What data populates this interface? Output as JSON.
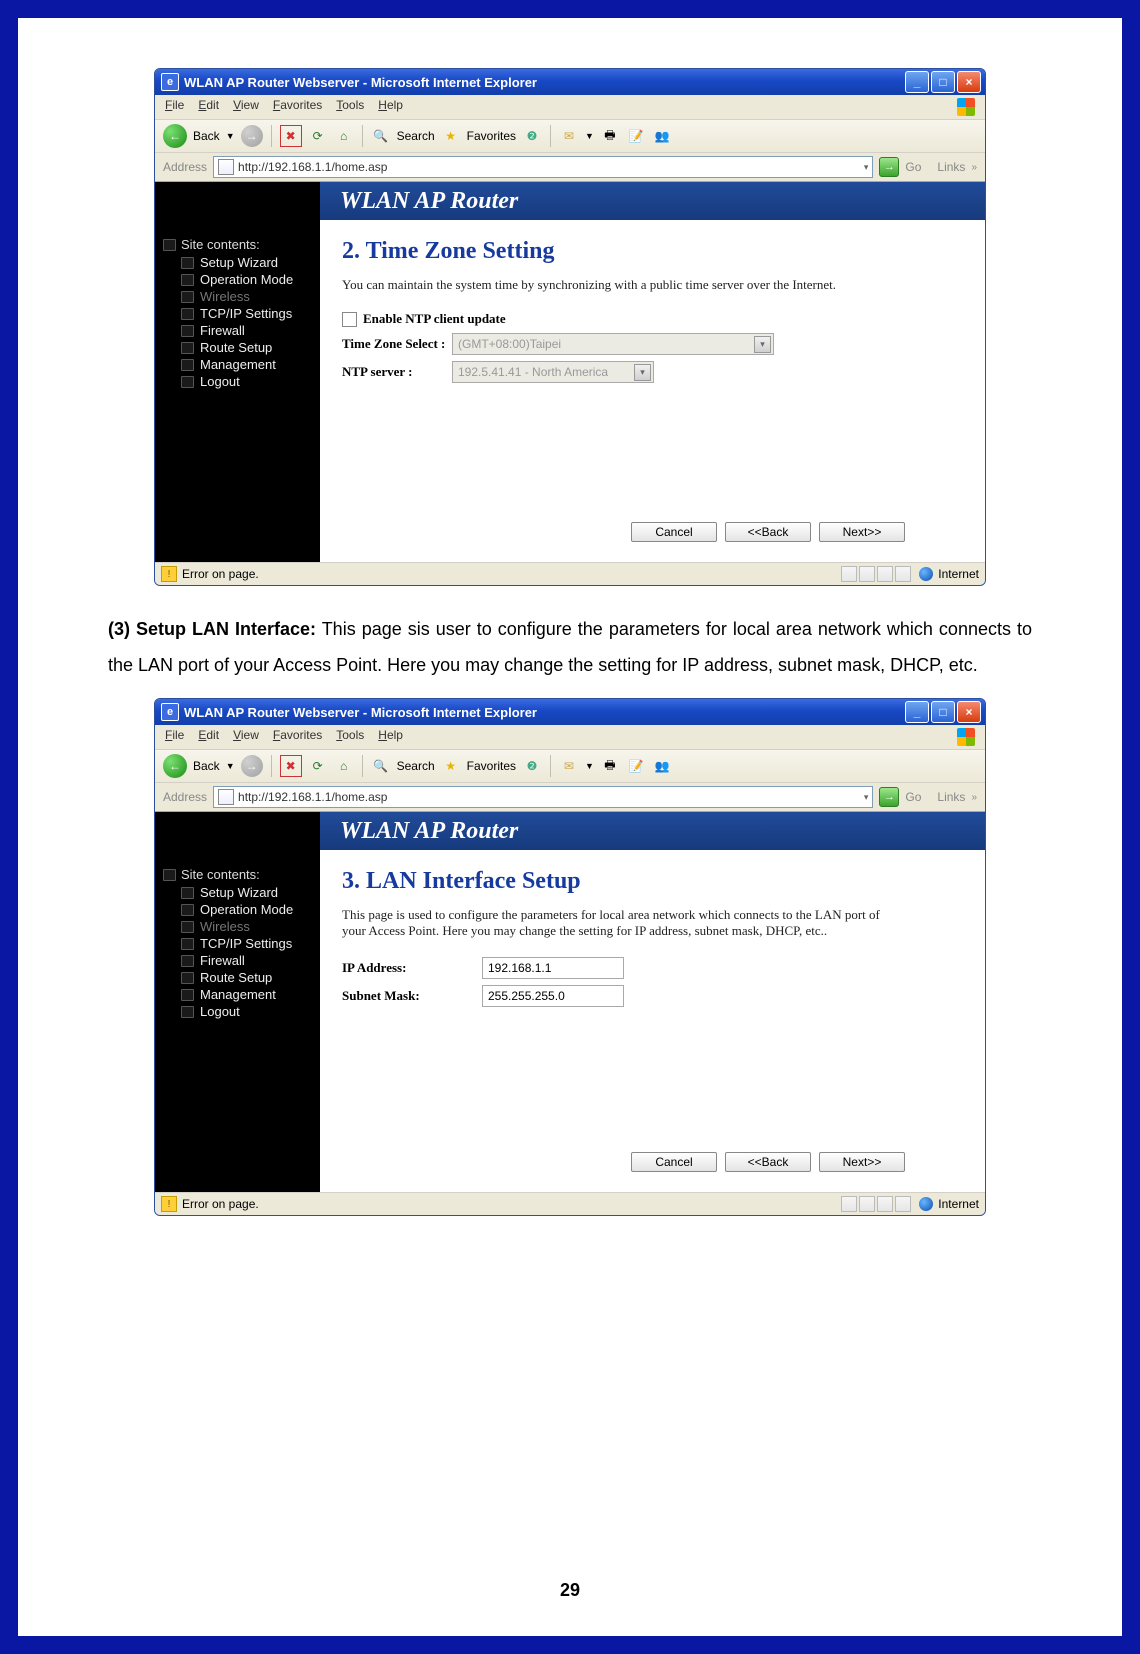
{
  "page_number": "29",
  "caption": {
    "bold": "(3) Setup LAN Interface:",
    "rest": " This page sis user to configure the parameters for local area network which connects to the LAN port of your Access Point. Here you may change the setting for IP address, subnet mask, DHCP, etc."
  },
  "ie": {
    "title": "WLAN AP Router Webserver - Microsoft Internet Explorer",
    "menus": [
      "File",
      "Edit",
      "View",
      "Favorites",
      "Tools",
      "Help"
    ],
    "back_label": "Back",
    "search_label": "Search",
    "fav_label": "Favorites",
    "addr_label": "Address",
    "url": "http://192.168.1.1/home.asp",
    "go_label": "Go",
    "links_label": "Links",
    "status_error": "Error on page.",
    "status_zone": "Internet"
  },
  "router": {
    "banner": "WLAN AP Router",
    "sidebar_header": "Site contents:",
    "sidebar_items": [
      {
        "label": "Setup Wizard",
        "dim": false
      },
      {
        "label": "Operation Mode",
        "dim": false
      },
      {
        "label": "Wireless",
        "dim": true
      },
      {
        "label": "TCP/IP Settings",
        "dim": false
      },
      {
        "label": "Firewall",
        "dim": false
      },
      {
        "label": "Route Setup",
        "dim": false
      },
      {
        "label": "Management",
        "dim": false
      },
      {
        "label": "Logout",
        "dim": false
      }
    ],
    "buttons": {
      "cancel": "Cancel",
      "back": "<<Back",
      "next": "Next>>"
    }
  },
  "shot1": {
    "title": "2. Time Zone Setting",
    "desc": "You can maintain the system time by synchronizing with a public time server over the Internet.",
    "ntp_checkbox_label": "Enable NTP client update",
    "tz_label": "Time Zone Select :",
    "tz_value": "(GMT+08:00)Taipei",
    "ntp_label": "NTP server :",
    "ntp_value": "192.5.41.41 - North America"
  },
  "shot2": {
    "title": "3. LAN Interface Setup",
    "desc": "This page is used to configure the parameters for local area network which connects to the LAN port of your Access Point. Here you may change the setting for IP address, subnet mask, DHCP, etc..",
    "ip_label": "IP Address:",
    "ip_value": "192.168.1.1",
    "mask_label": "Subnet Mask:",
    "mask_value": "255.255.255.0"
  }
}
